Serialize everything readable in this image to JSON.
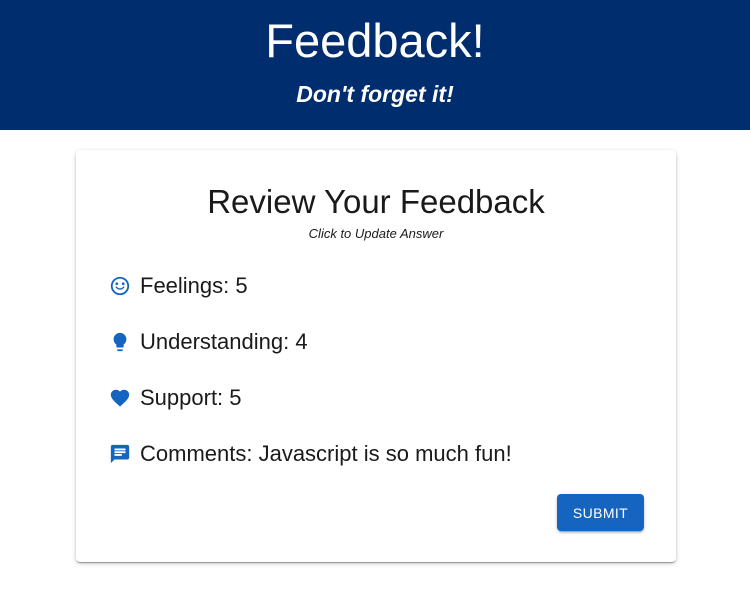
{
  "header": {
    "title": "Feedback!",
    "subtitle": "Don't forget it!"
  },
  "review": {
    "title": "Review Your Feedback",
    "hint": "Click to Update Answer",
    "items": [
      {
        "icon": "smiley-face-icon",
        "text": "Feelings: 5"
      },
      {
        "icon": "lightbulb-icon",
        "text": "Understanding: 4"
      },
      {
        "icon": "heart-icon",
        "text": "Support: 5"
      },
      {
        "icon": "comment-icon",
        "text": "Comments: Javascript is so much fun!"
      }
    ],
    "submit_label": "SUBMIT"
  },
  "colors": {
    "header_bg": "#002d6e",
    "accent": "#1565c0"
  }
}
